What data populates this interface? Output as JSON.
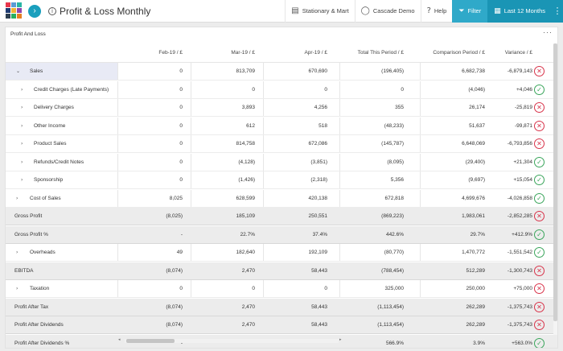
{
  "app": {
    "title": "Profit & Loss Monthly",
    "brand_colors": [
      "#e8374c",
      "#5b9bd5",
      "#2ab5a5",
      "#1f3b72",
      "#f2b134",
      "#8e44ad",
      "#2d3e50",
      "#27ae60",
      "#e67e22"
    ]
  },
  "topbar": {
    "company": "Stationary & Mart",
    "user": "Cascade Demo",
    "help": "Help",
    "filter": "Filter",
    "period": "Last 12 Months"
  },
  "panel": {
    "title": "Profit And Loss",
    "menu": "···"
  },
  "columns": [
    "Feb-19 / £",
    "Mar-19 / £",
    "Apr-19 / £",
    "Total This Period / £",
    "Comparison Period / £",
    "Variance / £"
  ],
  "rows": [
    {
      "label": "Sales",
      "level": 0,
      "chevron": "⌄",
      "expandable": true,
      "active": true,
      "values": [
        "0",
        "813,709",
        "670,690",
        "(196,405)",
        "6,682,738",
        "-6,879,143"
      ],
      "status": "bad"
    },
    {
      "label": "Credit Charges (Late Payments)",
      "level": 1,
      "chevron": "›",
      "expandable": true,
      "values": [
        "0",
        "0",
        "0",
        "0",
        "(4,046)",
        "+4,046"
      ],
      "status": "good"
    },
    {
      "label": "Delivery Charges",
      "level": 1,
      "chevron": "›",
      "expandable": true,
      "values": [
        "0",
        "3,893",
        "4,256",
        "355",
        "26,174",
        "-25,819"
      ],
      "status": "bad"
    },
    {
      "label": "Other Income",
      "level": 1,
      "chevron": "›",
      "expandable": true,
      "values": [
        "0",
        "612",
        "518",
        "(48,233)",
        "51,637",
        "-99,871"
      ],
      "status": "bad"
    },
    {
      "label": "Product Sales",
      "level": 1,
      "chevron": "›",
      "expandable": true,
      "values": [
        "0",
        "814,758",
        "672,086",
        "(145,787)",
        "6,648,069",
        "-6,793,856"
      ],
      "status": "bad"
    },
    {
      "label": "Refunds/Credit Notes",
      "level": 1,
      "chevron": "›",
      "expandable": true,
      "values": [
        "0",
        "(4,128)",
        "(3,851)",
        "(8,095)",
        "(29,400)",
        "+21,304"
      ],
      "status": "good"
    },
    {
      "label": "Sponsorship",
      "level": 1,
      "chevron": "›",
      "expandable": true,
      "values": [
        "0",
        "(1,426)",
        "(2,318)",
        "5,356",
        "(9,697)",
        "+15,054"
      ],
      "status": "good"
    },
    {
      "label": "Cost of Sales",
      "level": 0,
      "chevron": "›",
      "expandable": true,
      "values": [
        "8,025",
        "628,599",
        "420,138",
        "672,818",
        "4,699,676",
        "-4,026,858"
      ],
      "status": "good"
    },
    {
      "label": "Gross Profit",
      "level": 0,
      "subtotal": true,
      "values": [
        "(8,025)",
        "185,109",
        "250,551",
        "(869,223)",
        "1,983,061",
        "-2,852,285"
      ],
      "status": "bad"
    },
    {
      "label": "Gross Profit %",
      "level": 0,
      "subtotal": true,
      "values": [
        "-",
        "22.7%",
        "37.4%",
        "442.6%",
        "29.7%",
        "+412.9%"
      ],
      "status": "good"
    },
    {
      "label": "Overheads",
      "level": 0,
      "chevron": "›",
      "expandable": true,
      "values": [
        "49",
        "182,640",
        "192,109",
        "(80,770)",
        "1,470,772",
        "-1,551,542"
      ],
      "status": "good"
    },
    {
      "label": "EBITDA",
      "level": 0,
      "subtotal": true,
      "values": [
        "(8,074)",
        "2,470",
        "58,443",
        "(788,454)",
        "512,289",
        "-1,300,743"
      ],
      "status": "bad"
    },
    {
      "label": "Taxation",
      "level": 0,
      "chevron": "›",
      "expandable": true,
      "values": [
        "0",
        "0",
        "0",
        "325,000",
        "250,000",
        "+75,000"
      ],
      "status": "bad"
    },
    {
      "label": "Profit After Tax",
      "level": 0,
      "subtotal": true,
      "values": [
        "(8,074)",
        "2,470",
        "58,443",
        "(1,113,454)",
        "262,289",
        "-1,375,743"
      ],
      "status": "bad"
    },
    {
      "label": "Profit After Dividends",
      "level": 0,
      "subtotal": true,
      "values": [
        "(8,074)",
        "2,470",
        "58,443",
        "(1,113,454)",
        "262,289",
        "-1,375,743"
      ],
      "status": "bad"
    },
    {
      "label": "Profit After Dividends %",
      "level": 0,
      "subtotal": true,
      "values": [
        "-",
        "",
        "",
        "566.9%",
        "3.9%",
        "+563.0%"
      ],
      "status": "good"
    }
  ]
}
